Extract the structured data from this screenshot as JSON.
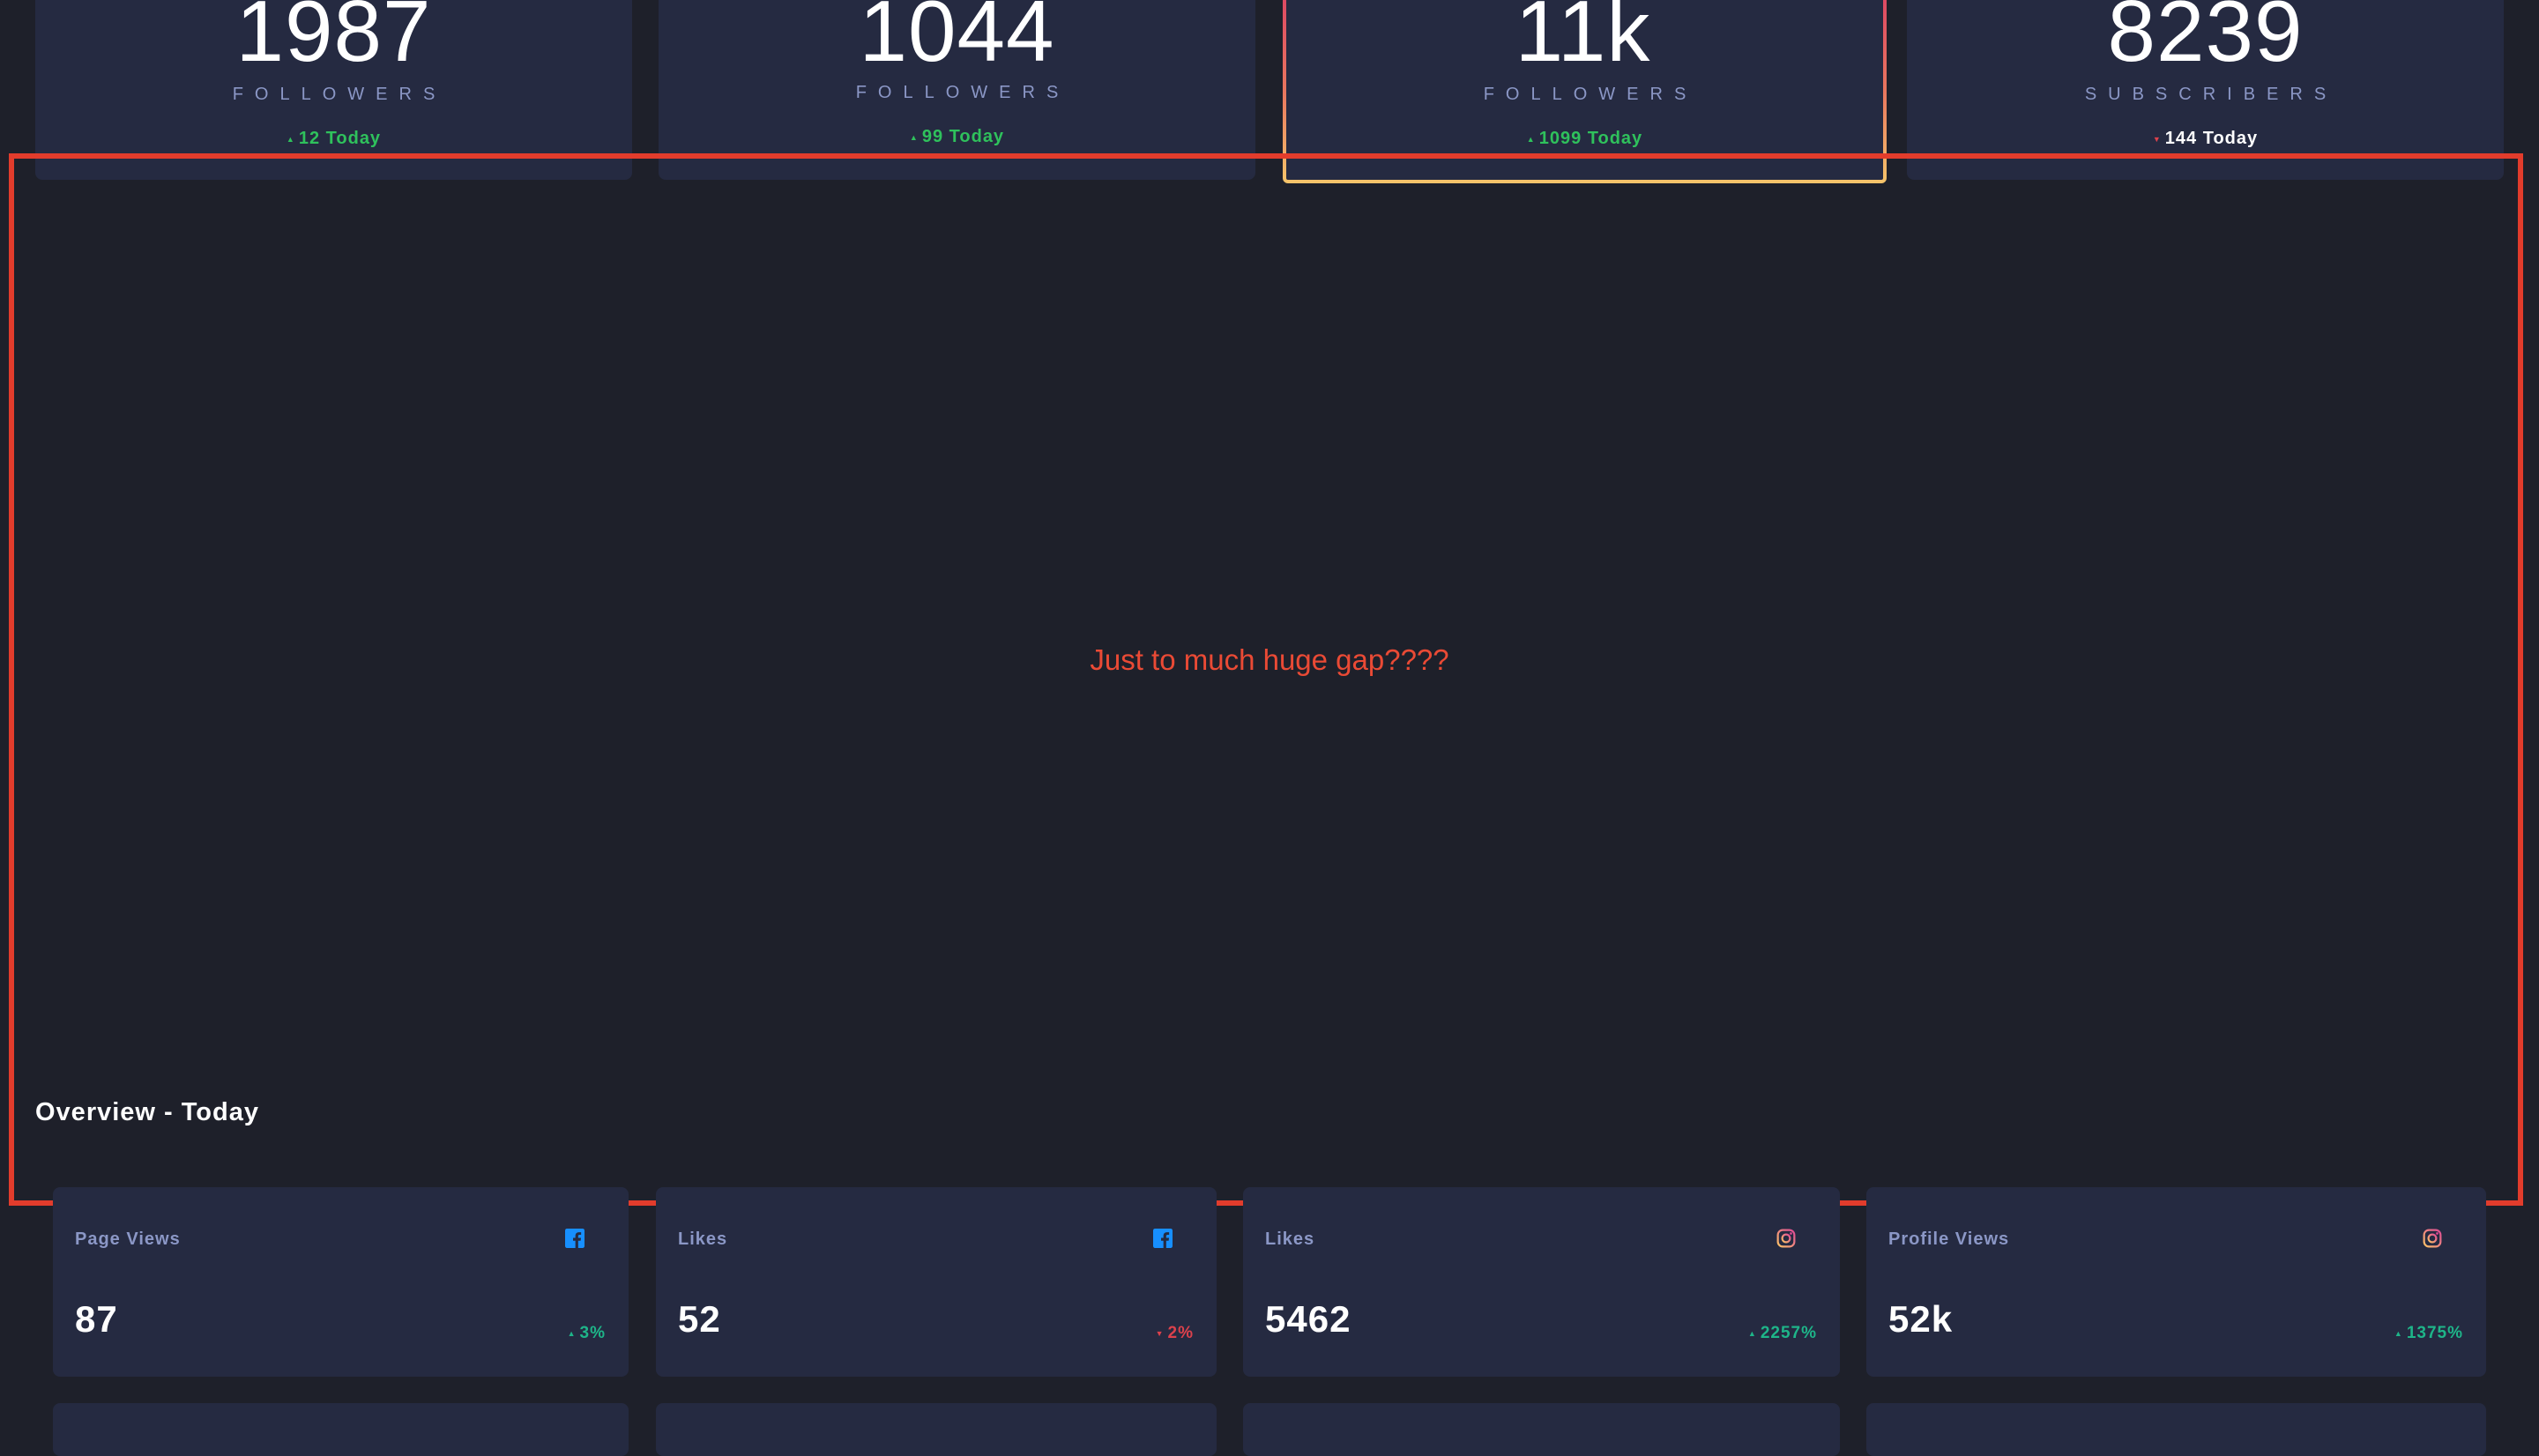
{
  "top_cards": [
    {
      "count": "1987",
      "unit": "FOLLOWERS",
      "today": "12 Today"
    },
    {
      "count": "1044",
      "unit": "FOLLOWERS",
      "today": "99 Today"
    },
    {
      "count": "11k",
      "unit": "FOLLOWERS",
      "today": "1099 Today"
    },
    {
      "count": "8239",
      "unit": "SUBSCRIBERS",
      "today": "144 Today"
    }
  ],
  "annotation": {
    "note": "Just to much huge gap????"
  },
  "overview": {
    "title": "Overview - Today",
    "cards": [
      {
        "label": "Page Views",
        "icon": "facebook-icon",
        "value": "87",
        "change": "3%",
        "trend": "up"
      },
      {
        "label": "Likes",
        "icon": "facebook-icon",
        "value": "52",
        "change": "2%",
        "trend": "down"
      },
      {
        "label": "Likes",
        "icon": "instagram-icon",
        "value": "5462",
        "change": "2257%",
        "trend": "up"
      },
      {
        "label": "Profile Views",
        "icon": "instagram-icon",
        "value": "52k",
        "change": "1375%",
        "trend": "up"
      }
    ]
  },
  "colors": {
    "background": "#1e202a",
    "card": "#252a41",
    "muted_text": "#8b97c6",
    "up": "#1eb589",
    "down": "#dc414c",
    "annotation": "#e23c2c",
    "facebook": "#178ffe",
    "instagram_start": "#fdc468",
    "instagram_end": "#df4996"
  }
}
